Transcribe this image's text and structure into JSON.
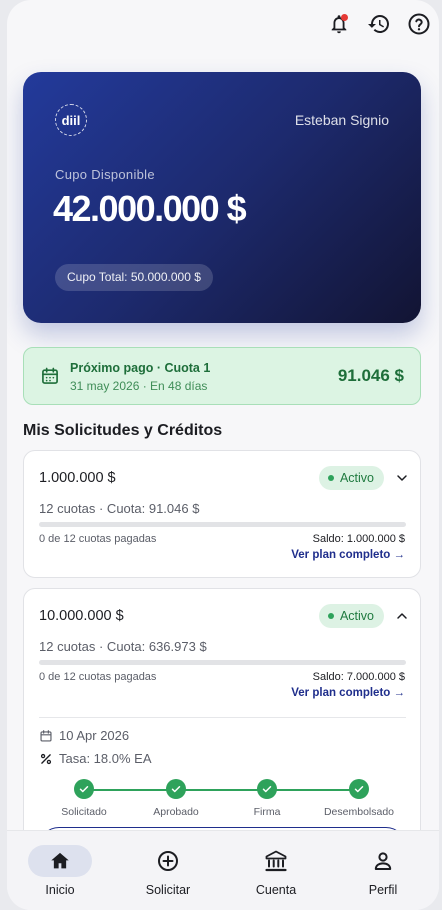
{
  "card": {
    "logo_text": "diil",
    "holder_name": "Esteban Signio",
    "available_label": "Cupo Disponible",
    "available_amount": "42.000.000 $",
    "total_label": "Cupo Total: 50.000.000 $"
  },
  "next_payment": {
    "title": "Próximo pago · Cuota 1",
    "subtitle": "31 may 2026 · En 48 días",
    "amount": "91.046 $"
  },
  "section_title": "Mis Solicitudes y Créditos",
  "loans": [
    {
      "amount": "1.000.000 $",
      "status": "Activo",
      "quota": "12 cuotas · Cuota: 91.046 $",
      "progress": 0,
      "paid": "0 de 12 cuotas pagadas",
      "saldo": "Saldo: 1.000.000 $",
      "link": "Ver plan completo →",
      "expanded": false
    },
    {
      "amount": "10.000.000 $",
      "status": "Activo",
      "quota": "12 cuotas · Cuota: 636.973 $",
      "progress": 0,
      "paid": "0 de 12 cuotas pagadas",
      "saldo": "Saldo: 7.000.000 $",
      "link": "Ver plan completo →",
      "expanded": true,
      "date": "10 Apr 2026",
      "rate": "Tasa: 18.0% EA",
      "steps": [
        "Solicitado",
        "Aprobado",
        "Firma",
        "Desembolsado"
      ]
    }
  ],
  "nav": [
    {
      "label": "Inicio",
      "icon": "home-icon",
      "active": true
    },
    {
      "label": "Solicitar",
      "icon": "add-circle-icon",
      "active": false
    },
    {
      "label": "Cuenta",
      "icon": "bank-icon",
      "active": false
    },
    {
      "label": "Perfil",
      "icon": "person-icon",
      "active": false
    }
  ],
  "colors": {
    "brand": "#233a9b",
    "success": "#2ea25b",
    "alert": "#e53935"
  }
}
